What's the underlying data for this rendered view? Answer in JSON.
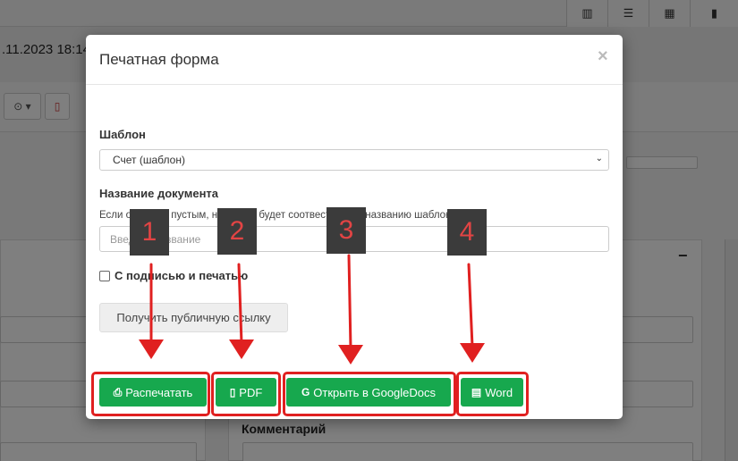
{
  "background": {
    "date_text": ".11.2023 18:14",
    "comment_label": "Комментарий",
    "toolbar_icons": [
      "barcode-icon",
      "list-icon",
      "calendar-icon",
      "book-icon"
    ]
  },
  "modal": {
    "title": "Печатная форма",
    "close_glyph": "×",
    "template_label": "Шаблон",
    "template_value": "Счет (шаблон)",
    "doc_name_label": "Название документа",
    "doc_name_help": "Если оставить пустым, название будет соотвествовать названию шаблона",
    "doc_name_placeholder": "Введите название",
    "signature_label": "С подписью и печатью",
    "public_link_button": "Получить публичную ссылку",
    "buttons": {
      "print": "Распечатать",
      "pdf": "PDF",
      "google_docs": "Открыть в GoogleDocs",
      "word": "Word"
    }
  },
  "annotations": [
    "1",
    "2",
    "3",
    "4"
  ],
  "colors": {
    "primary_green": "#17a84e",
    "highlight_red": "#e02020",
    "label_bg": "#3b3b3b",
    "label_text": "#e24444"
  }
}
